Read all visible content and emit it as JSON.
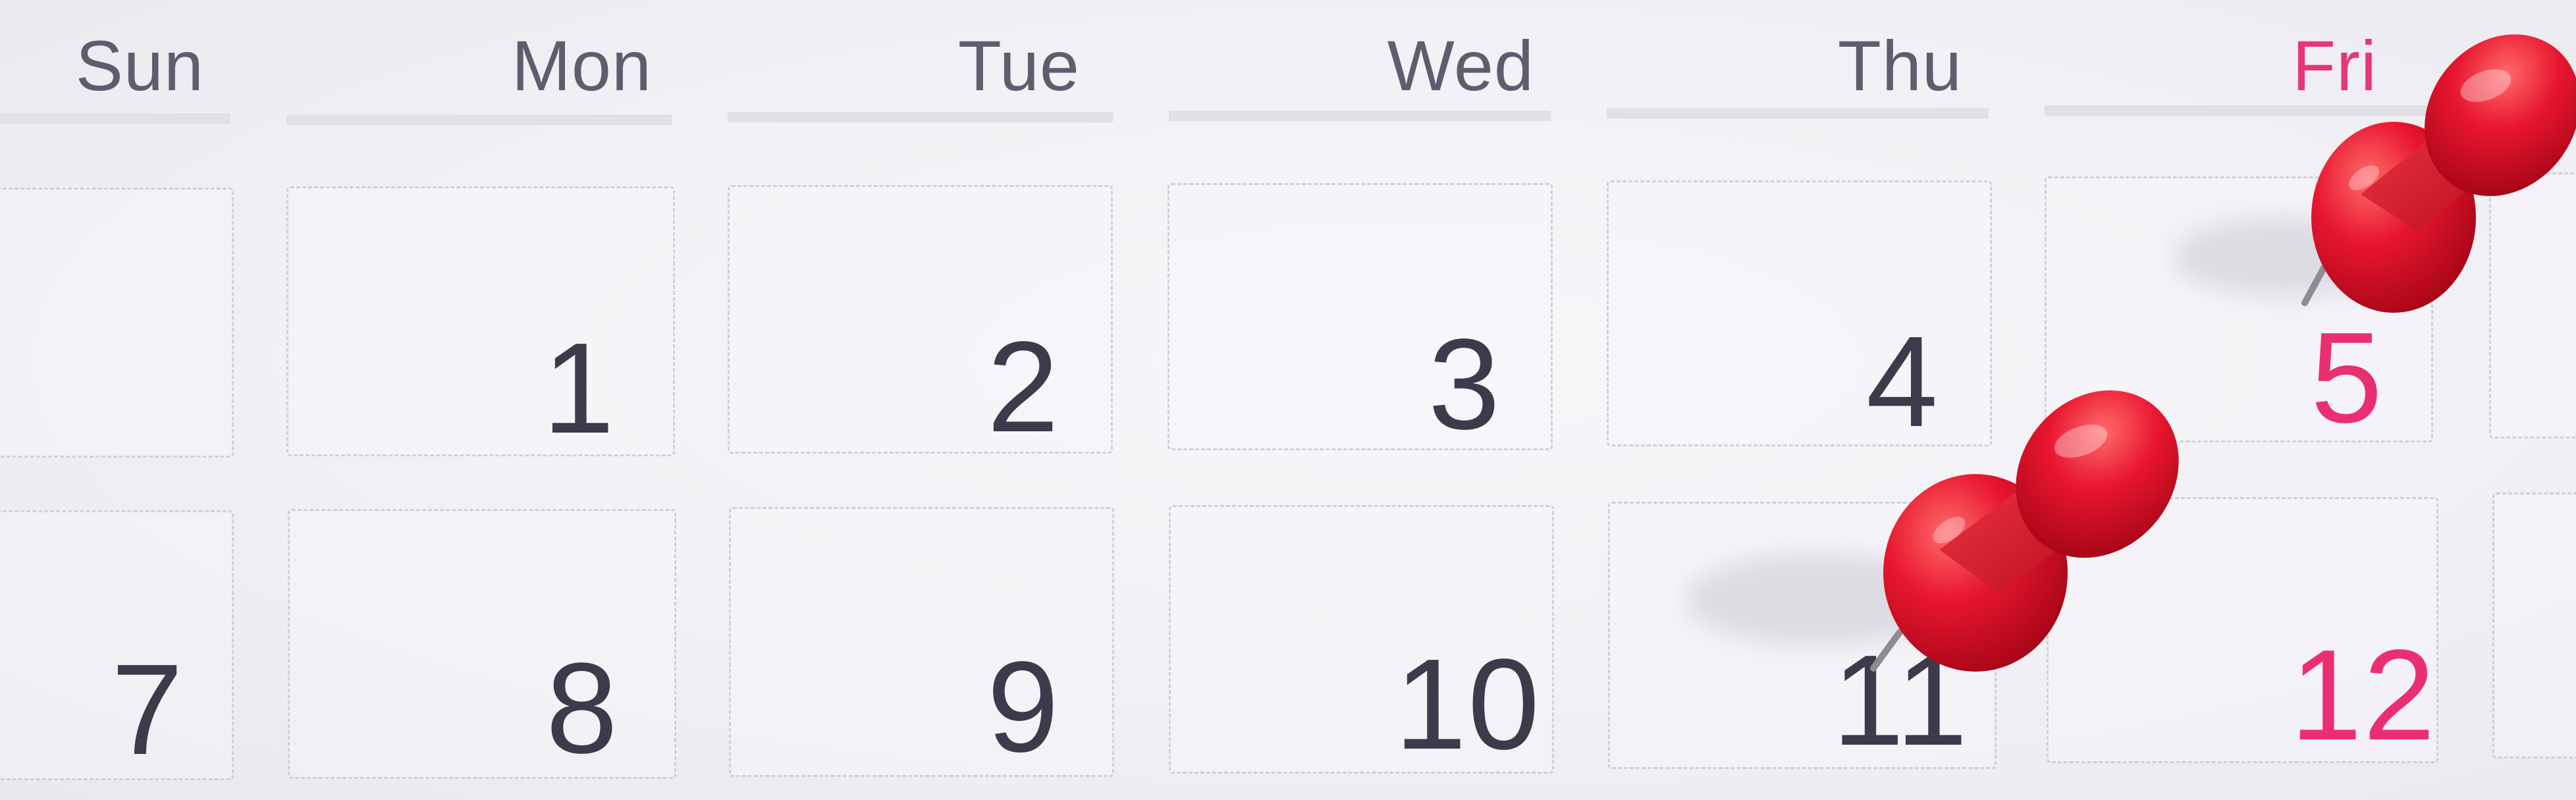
{
  "calendar": {
    "weekdays": {
      "sun": "Sun",
      "mon": "Mon",
      "tue": "Tue",
      "wed": "Wed",
      "thu": "Thu",
      "fri": "Fri"
    },
    "week1": {
      "mon": "1",
      "tue": "2",
      "wed": "3",
      "thu": "4",
      "fri": "5"
    },
    "week2": {
      "sun": "7",
      "mon": "8",
      "tue": "9",
      "wed": "10",
      "thu": "11",
      "fri": "12"
    }
  },
  "pushpins": [
    {
      "icon": "pushpin-icon",
      "color": "#e8162f",
      "marks_date": "5"
    },
    {
      "icon": "pushpin-icon",
      "color": "#e8162f",
      "marks_date": "11"
    }
  ],
  "colors": {
    "paper": "#f1f0f4",
    "weekday_text": "#5f5d6d",
    "date_text": "#3c3a4b",
    "friday_red": "#ea2f70",
    "pin_red": "#e8162f"
  }
}
